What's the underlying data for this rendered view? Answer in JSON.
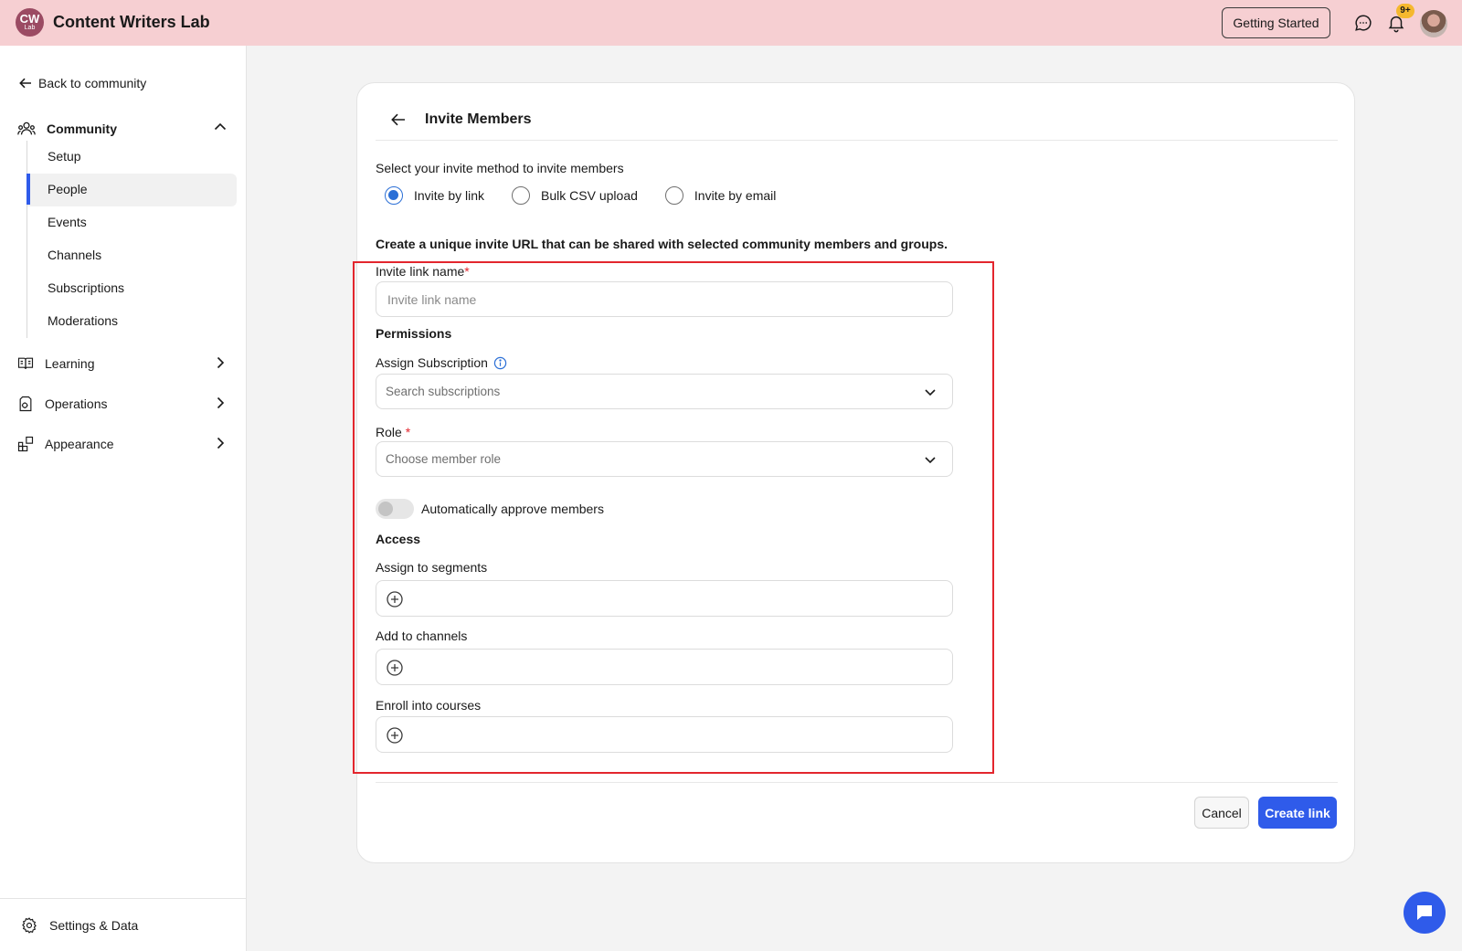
{
  "app": {
    "logo_text": "CW",
    "logo_sub": "Lab",
    "title": "Content Writers Lab"
  },
  "topbar": {
    "getting_started_label": "Getting Started",
    "notification_badge": "9+"
  },
  "sidebar": {
    "back_label": "Back to community",
    "community_label": "Community",
    "community_items": [
      {
        "label": "Setup",
        "active": false
      },
      {
        "label": "People",
        "active": true
      },
      {
        "label": "Events",
        "active": false
      },
      {
        "label": "Channels",
        "active": false
      },
      {
        "label": "Subscriptions",
        "active": false
      },
      {
        "label": "Moderations",
        "active": false
      }
    ],
    "sections": [
      {
        "label": "Learning",
        "icon": "book-icon"
      },
      {
        "label": "Operations",
        "icon": "operations-icon"
      },
      {
        "label": "Appearance",
        "icon": "appearance-icon"
      }
    ],
    "settings_label": "Settings & Data"
  },
  "main": {
    "title": "Invite Members",
    "method_prompt": "Select your invite method to invite members",
    "methods": [
      {
        "label": "Invite by link",
        "selected": true
      },
      {
        "label": "Bulk CSV upload",
        "selected": false
      },
      {
        "label": "Invite by email",
        "selected": false
      }
    ],
    "description": "Create a unique invite URL that can be shared with selected community members and groups.",
    "invite_link_name": {
      "label": "Invite link name",
      "required_mark": "*",
      "value": "",
      "placeholder": "Invite link name"
    },
    "permissions_heading": "Permissions",
    "assign_subscription": {
      "label": "Assign Subscription",
      "placeholder": "Search subscriptions"
    },
    "role": {
      "label": "Role",
      "required_mark": "*",
      "placeholder": "Choose member role"
    },
    "auto_approve": {
      "label": "Automatically approve members",
      "enabled": false
    },
    "access_heading": "Access",
    "assign_segments_label": "Assign to segments",
    "add_channels_label": "Add to channels",
    "enroll_courses_label": "Enroll into courses",
    "cancel_label": "Cancel",
    "create_label": "Create link"
  },
  "colors": {
    "topbar_bg": "#f6cfd2",
    "accent": "#2f5bea",
    "highlight_border": "#e3262e",
    "badge": "#f5b82e"
  }
}
